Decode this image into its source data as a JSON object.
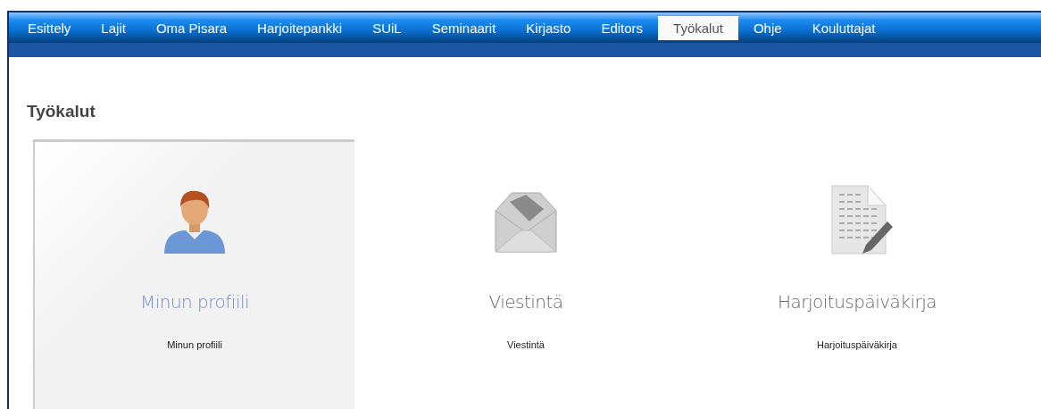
{
  "nav": {
    "tabs": [
      {
        "label": "Esittely",
        "selected": false
      },
      {
        "label": "Lajit",
        "selected": false
      },
      {
        "label": "Oma Pisara",
        "selected": false
      },
      {
        "label": "Harjoitepankki",
        "selected": false
      },
      {
        "label": "SUiL",
        "selected": false
      },
      {
        "label": "Seminaarit",
        "selected": false
      },
      {
        "label": "Kirjasto",
        "selected": false
      },
      {
        "label": "Editors",
        "selected": false
      },
      {
        "label": "Työkalut",
        "selected": true
      },
      {
        "label": "Ohje",
        "selected": false
      },
      {
        "label": "Kouluttajat",
        "selected": false
      }
    ]
  },
  "page": {
    "title": "Työkalut",
    "tools": [
      {
        "kind": "person",
        "title": "Minun profiili",
        "caption": "Minun profiili",
        "selected": true
      },
      {
        "kind": "envelope",
        "title": "Viestintä",
        "caption": "Viestintä",
        "selected": false
      },
      {
        "kind": "document",
        "title": "Harjoituspäiväkirja",
        "caption": "Harjoituspäiväkirja",
        "selected": false
      }
    ]
  }
}
